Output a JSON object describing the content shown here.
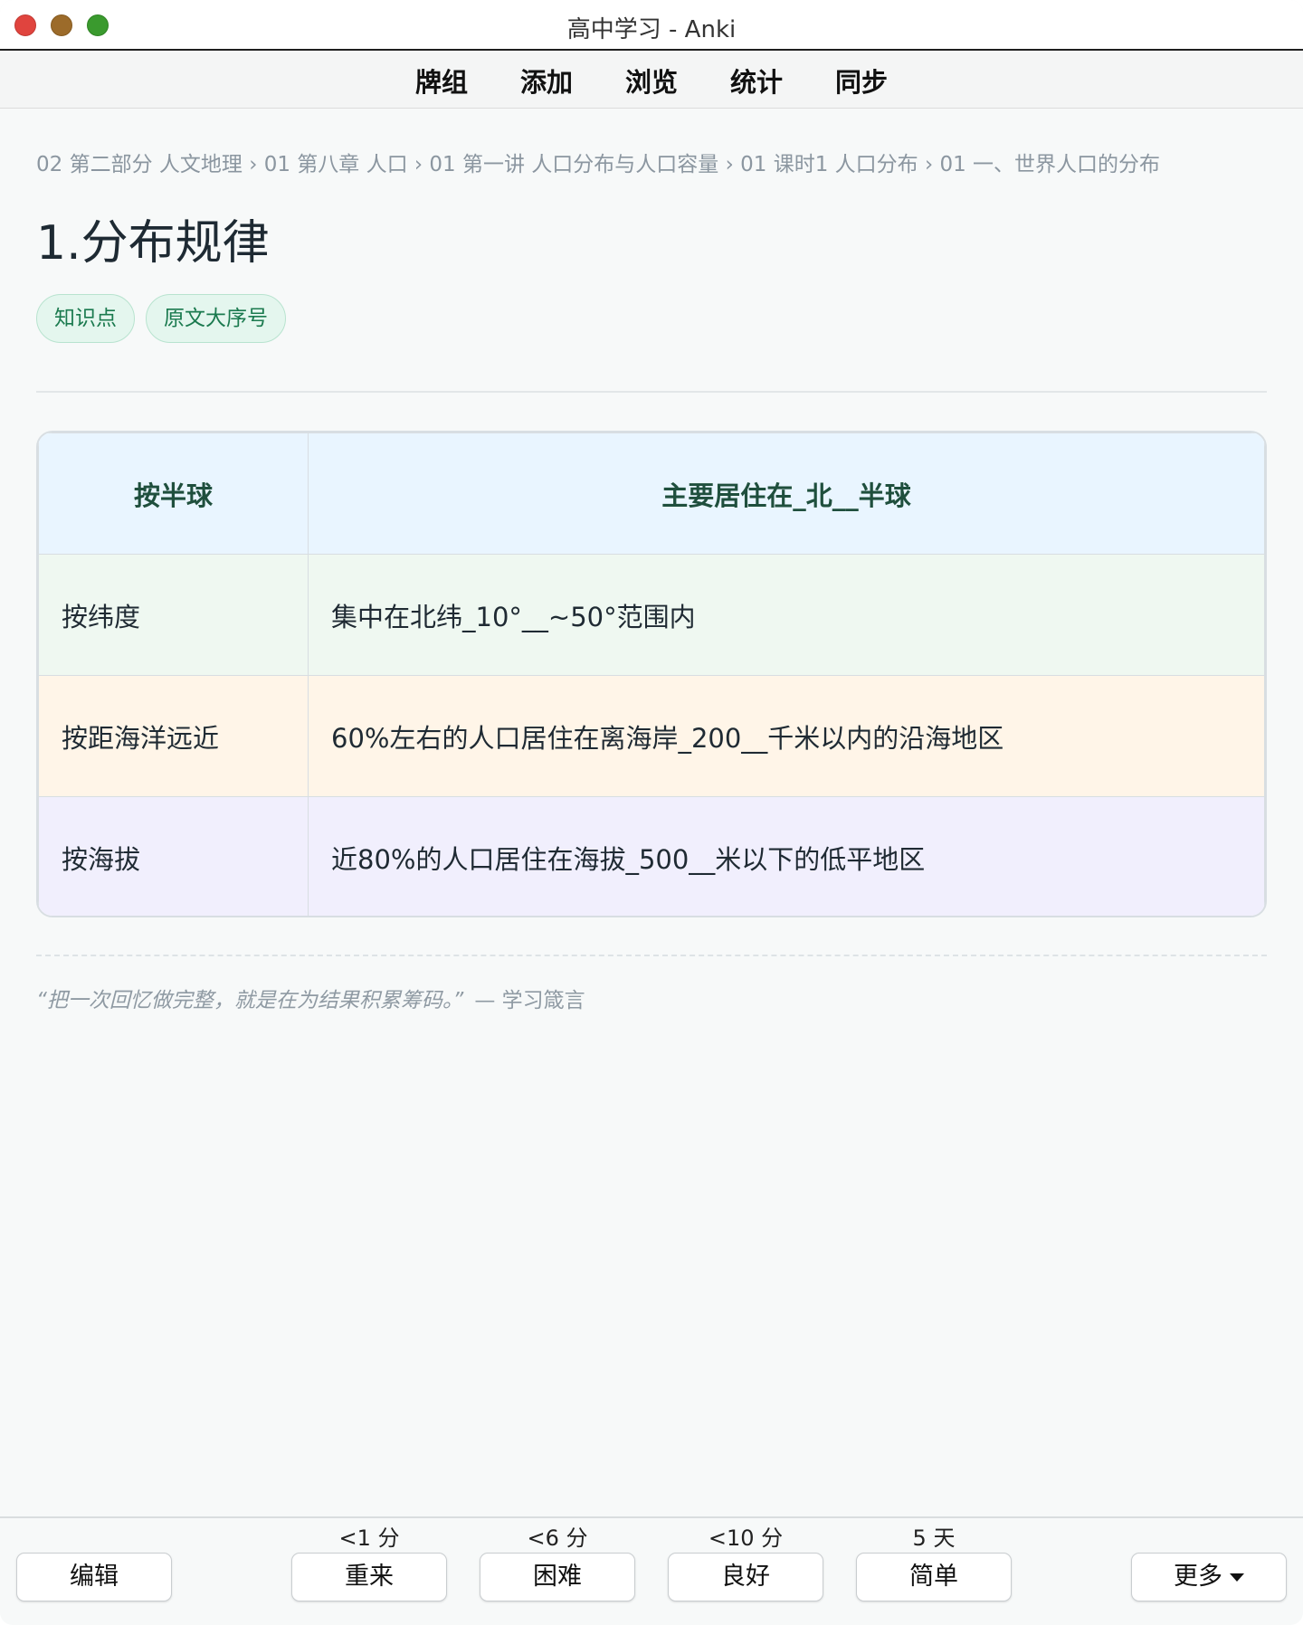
{
  "window": {
    "title": "高中学习 - Anki"
  },
  "toolbar": {
    "items": [
      "牌组",
      "添加",
      "浏览",
      "统计",
      "同步"
    ]
  },
  "card": {
    "breadcrumb": "02 第二部分 人文地理 › 01 第八章 人口 › 01 第一讲 人口分布与人口容量 › 01 课时1 人口分布 › 01 一、世界人口的分布",
    "title": "1.分布规律",
    "tags": [
      "知识点",
      "原文大序号"
    ],
    "table": {
      "header": [
        "按半球",
        "主要居住在_北__半球"
      ],
      "rows": [
        [
          "按纬度",
          "集中在北纬_10°__~50°范围内"
        ],
        [
          "按距海洋远近",
          "60%左右的人口居住在离海岸_200__千米以内的沿海地区"
        ],
        [
          "按海拔",
          "近80%的人口居住在海拔_500__米以下的低平地区"
        ]
      ]
    },
    "quote": {
      "text": "“把一次回忆做完整，就是在为结果积累筹码。”",
      "source": "— 学习箴言"
    }
  },
  "review": {
    "edit_label": "编辑",
    "more_label": "更多",
    "answers": [
      {
        "interval": "<1 分",
        "label": "重来"
      },
      {
        "interval": "<6 分",
        "label": "困难"
      },
      {
        "interval": "<10 分",
        "label": "良好"
      },
      {
        "interval": "5 天",
        "label": "简单"
      }
    ]
  },
  "colors": {
    "tag_bg": "#e4f6ee",
    "tag_text": "#1b7a4f",
    "header_row": "#e9f5ff",
    "row_green": "#eff8f1",
    "row_orange": "#fff5e8",
    "row_purple": "#f1effd"
  },
  "icons": [
    "close-icon",
    "minimize-icon",
    "zoom-icon",
    "caret-down-icon"
  ]
}
